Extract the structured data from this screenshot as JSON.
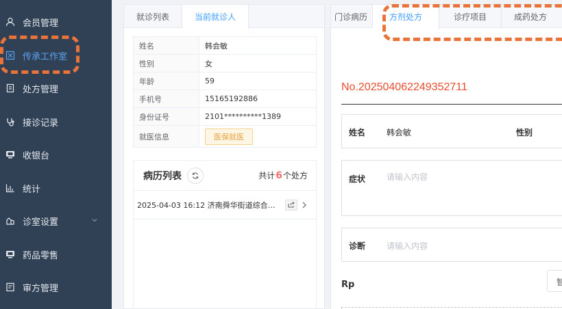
{
  "sidebar": {
    "items": [
      {
        "label": "会员管理",
        "icon": "user-icon"
      },
      {
        "label": "传承工作室",
        "icon": "studio-icon",
        "active": true
      },
      {
        "label": "处方管理",
        "icon": "document-icon"
      },
      {
        "label": "接诊记录",
        "icon": "stethoscope-icon"
      },
      {
        "label": "收银台",
        "icon": "monitor-icon"
      },
      {
        "label": "统计",
        "icon": "chart-icon"
      },
      {
        "label": "诊室设置",
        "icon": "settings-icon"
      },
      {
        "label": "药品零售",
        "icon": "monitor-icon"
      },
      {
        "label": "审方管理",
        "icon": "review-icon"
      }
    ]
  },
  "middle": {
    "tabs": [
      "就诊列表",
      "当前就诊人"
    ],
    "active_tab": "当前就诊人",
    "patient": {
      "rows": [
        {
          "key": "姓名",
          "value": "韩会敏"
        },
        {
          "key": "性别",
          "value": "女"
        },
        {
          "key": "年龄",
          "value": "59"
        },
        {
          "key": "手机号",
          "value": "15165192886"
        },
        {
          "key": "身份证号",
          "value": "2101**********1389"
        }
      ],
      "visit_key": "就医信息",
      "visit_badge": "医保就医"
    },
    "records": {
      "title": "病历列表",
      "count_prefix": "共计",
      "count": "6",
      "count_suffix": "个处方",
      "items": [
        "2025-04-03 16:12 济南舜华街道综合养..."
      ]
    }
  },
  "right": {
    "tabs": [
      "门诊病历",
      "方剂处方",
      "诊疗项目",
      "成药处方"
    ],
    "active_tab": "方剂处方",
    "rx_number": "No.202504062249352711",
    "name_label": "姓名",
    "name_value": "韩会敏",
    "gender_label": "性别",
    "symptom_label": "症状",
    "symptom_placeholder": "请输入内容",
    "diagnosis_label": "诊断",
    "diagnosis_placeholder": "请输入内容",
    "rp_label": "Rp",
    "rp_button": "智"
  },
  "colors": {
    "sidebar_bg": "#304156",
    "active_blue": "#409eff",
    "highlight_orange": "#e8743b",
    "rx_red": "#e84b2e"
  }
}
